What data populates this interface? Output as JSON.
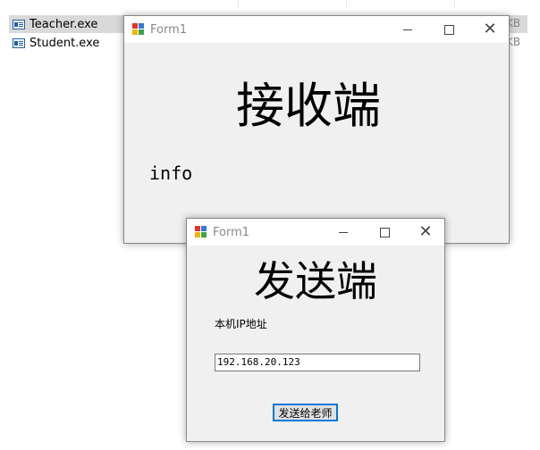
{
  "explorer": {
    "files": [
      {
        "name": "Teacher.exe",
        "size_tail": "KB"
      },
      {
        "name": "Student.exe",
        "size_tail": "KB"
      }
    ]
  },
  "receiver_window": {
    "title": "Form1",
    "heading": "接收端",
    "info": "info"
  },
  "sender_window": {
    "title": "Form1",
    "heading": "发送端",
    "ip_label": "本机IP地址",
    "ip_value": "192.168.20.123",
    "send_button": "发送给老师"
  },
  "icons": [
    "winforms-app-icon",
    "minimize-icon",
    "maximize-icon",
    "close-icon",
    "exe-file-icon"
  ]
}
